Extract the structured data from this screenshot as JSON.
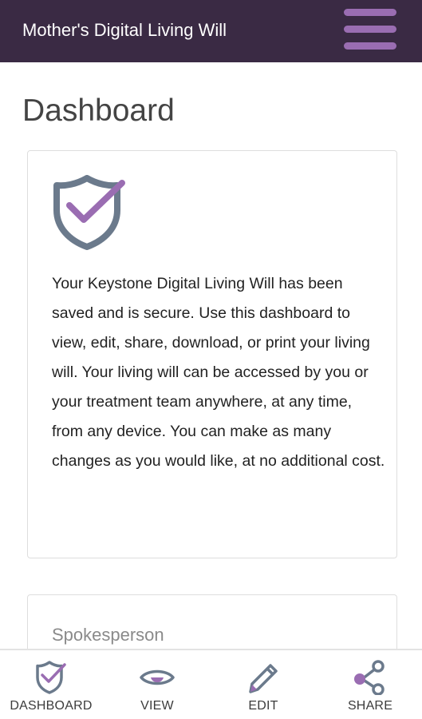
{
  "header": {
    "title": "Mother's Digital Living Will",
    "menu_icon": "hamburger-menu-icon"
  },
  "page": {
    "title": "Dashboard"
  },
  "welcome_card": {
    "icon": "shield-check-icon",
    "text": "Your Keystone Digital Living Will has been saved and is secure. Use this dashboard to view, edit, share, download, or print your living will. Your living will can be accessed by you or your treatment team anywhere, at any time, from any device. You can make as many changes as you would like, at no additional cost."
  },
  "spokesperson_card": {
    "heading": "Spokesperson"
  },
  "bottom_nav": {
    "items": [
      {
        "label": "DASHBOARD",
        "icon": "shield-check-icon"
      },
      {
        "label": "VIEW",
        "icon": "eye-icon"
      },
      {
        "label": "EDIT",
        "icon": "pencil-icon"
      },
      {
        "label": "SHARE",
        "icon": "share-icon"
      }
    ]
  },
  "colors": {
    "header_bg": "#3a2a44",
    "accent": "#9a6db2",
    "icon_slate": "#6b7a8c"
  }
}
